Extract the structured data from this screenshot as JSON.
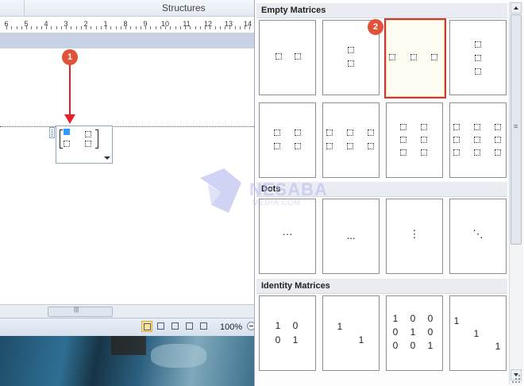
{
  "ribbon": {
    "group_label": "Structures"
  },
  "ruler": {
    "numbers": [
      "6",
      "5",
      "4",
      "3",
      "2",
      "1",
      "8",
      "9",
      "10",
      "11",
      "12",
      "13",
      "14"
    ]
  },
  "statusbar": {
    "zoom": "100%"
  },
  "annotations": {
    "step1": "1",
    "step2": "2"
  },
  "gallery": {
    "sections": {
      "empty": "Empty Matrices",
      "dots": "Dots",
      "identity": "Identity Matrices"
    },
    "dots_symbols": [
      "···",
      "...",
      "⋮",
      "⋱"
    ],
    "identity2": [
      "1",
      "0",
      "0",
      "1"
    ],
    "identity2_diag": [
      "1",
      "1"
    ],
    "identity3": [
      "1",
      "0",
      "0",
      "0",
      "1",
      "0",
      "0",
      "0",
      "1"
    ],
    "identity3_diag": [
      "1",
      "1",
      "1"
    ]
  },
  "watermark": {
    "name": "NESABA",
    "sub": "MEDIA.COM"
  },
  "colors": {
    "accent_red": "#e2212d",
    "badge": "#e0533a",
    "highlight_border": "#c6383b"
  }
}
